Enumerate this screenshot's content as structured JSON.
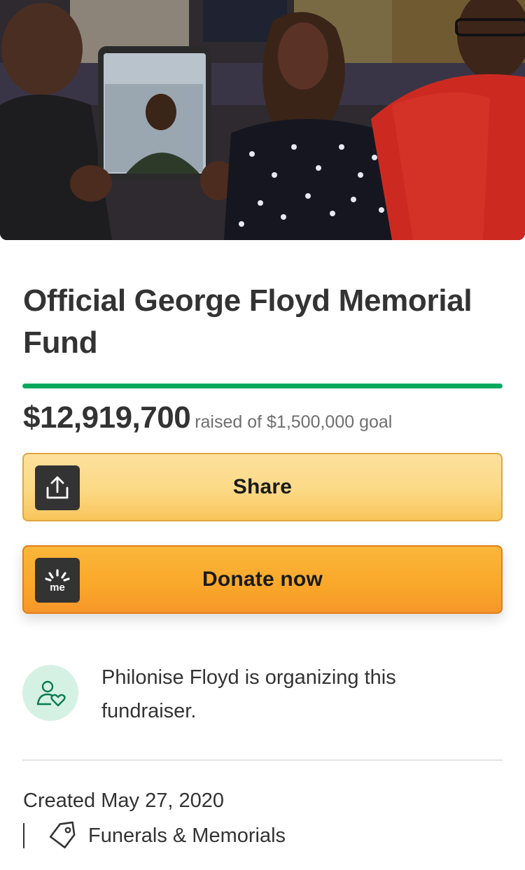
{
  "campaign": {
    "title": "Official George Floyd Memorial Fund",
    "raised_amount": "$12,919,700",
    "raised_suffix": "raised of $1,500,000 goal",
    "progress_fraction": 1.0,
    "accent_color": "#02a95c"
  },
  "actions": {
    "share_label": "Share",
    "share_icon": "share-upload-icon",
    "donate_label": "Donate now",
    "donate_icon": "gofundme-logo-icon"
  },
  "organizer": {
    "text": "Philonise Floyd is organizing this fundraiser.",
    "icon": "user-heart-icon"
  },
  "meta": {
    "created": "Created May 27, 2020",
    "category": "Funerals & Memorials",
    "category_icon": "tag-icon"
  }
}
